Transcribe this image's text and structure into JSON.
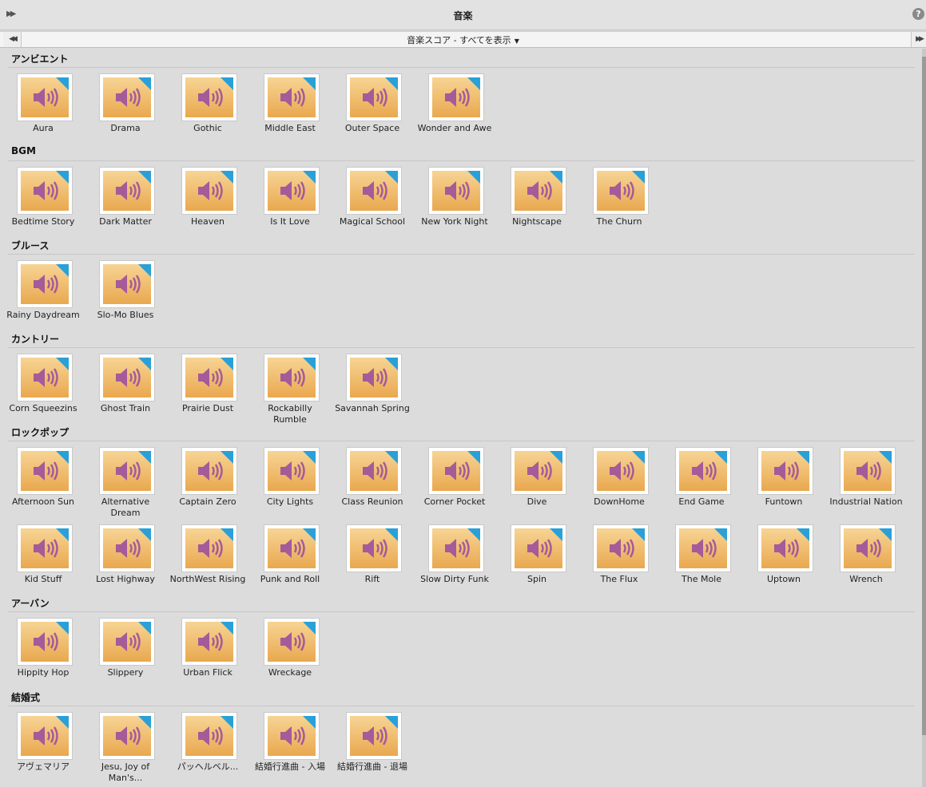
{
  "window": {
    "title": "音楽",
    "filter": "音楽スコア - すべてを表示"
  },
  "icons": {
    "collapse": "double-chevron-right-icon",
    "nav_left": "double-chevron-left-icon",
    "nav_right": "double-chevron-right-icon",
    "help": "question-mark-icon",
    "tile": "speaker-icon"
  },
  "colors": {
    "tile_gradient_top": "#f7d494",
    "tile_gradient_bottom": "#e9a84f",
    "speaker": "#a55a9a",
    "corner_badge": "#2aa0d8"
  },
  "sections": [
    {
      "title": "アンビエント",
      "items": [
        "Aura",
        "Drama",
        "Gothic",
        "Middle East",
        "Outer Space",
        "Wonder and Awe"
      ]
    },
    {
      "title": "BGM",
      "items": [
        "Bedtime Story",
        "Dark Matter",
        "Heaven",
        "Is It Love",
        "Magical School",
        "New York Night",
        "Nightscape",
        "The Churn"
      ]
    },
    {
      "title": "ブルース",
      "items": [
        "Rainy Daydream",
        "Slo-Mo Blues"
      ]
    },
    {
      "title": "カントリー",
      "items": [
        "Corn Squeezins",
        "Ghost Train",
        "Prairie Dust",
        "Rockabilly Rumble",
        "Savannah Spring"
      ]
    },
    {
      "title": "ロックポップ",
      "items": [
        "Afternoon Sun",
        "Alternative Dream",
        "Captain Zero",
        "City Lights",
        "Class Reunion",
        "Corner Pocket",
        "Dive",
        "DownHome",
        "End Game",
        "Funtown",
        "Industrial Nation",
        "Kid Stuff",
        "Lost Highway",
        "NorthWest Rising",
        "Punk and Roll",
        "Rift",
        "Slow Dirty Funk",
        "Spin",
        "The Flux",
        "The Mole",
        "Uptown",
        "Wrench"
      ]
    },
    {
      "title": "アーバン",
      "items": [
        "Hippity Hop",
        "Slippery",
        "Urban Flick",
        "Wreckage"
      ]
    },
    {
      "title": "結婚式",
      "items": [
        "アヴェマリア",
        "Jesu, Joy of Man's...",
        "パッヘルベル...",
        "結婚行進曲 - 入場",
        "結婚行進曲 - 退場"
      ]
    }
  ]
}
